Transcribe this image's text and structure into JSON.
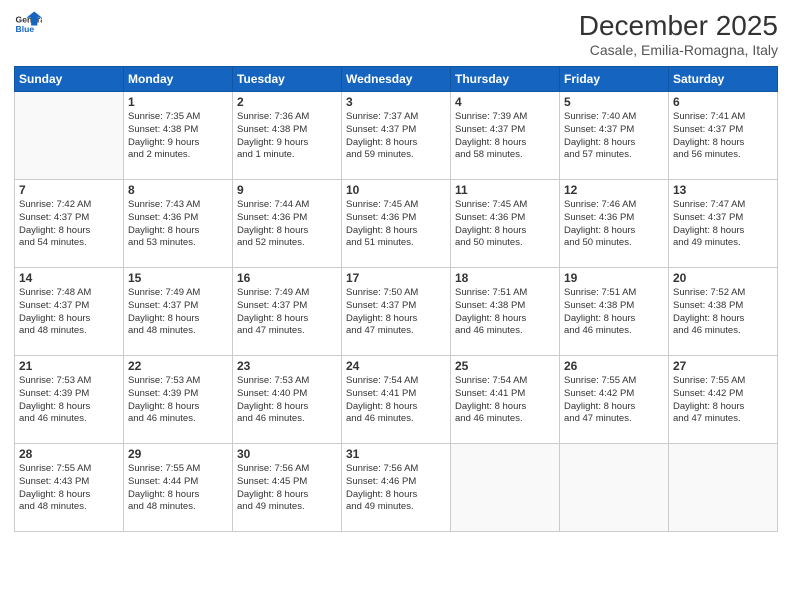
{
  "header": {
    "logo_general": "General",
    "logo_blue": "Blue",
    "month": "December 2025",
    "location": "Casale, Emilia-Romagna, Italy"
  },
  "weekdays": [
    "Sunday",
    "Monday",
    "Tuesday",
    "Wednesday",
    "Thursday",
    "Friday",
    "Saturday"
  ],
  "weeks": [
    [
      {
        "day": "",
        "info": ""
      },
      {
        "day": "1",
        "info": "Sunrise: 7:35 AM\nSunset: 4:38 PM\nDaylight: 9 hours\nand 2 minutes."
      },
      {
        "day": "2",
        "info": "Sunrise: 7:36 AM\nSunset: 4:38 PM\nDaylight: 9 hours\nand 1 minute."
      },
      {
        "day": "3",
        "info": "Sunrise: 7:37 AM\nSunset: 4:37 PM\nDaylight: 8 hours\nand 59 minutes."
      },
      {
        "day": "4",
        "info": "Sunrise: 7:39 AM\nSunset: 4:37 PM\nDaylight: 8 hours\nand 58 minutes."
      },
      {
        "day": "5",
        "info": "Sunrise: 7:40 AM\nSunset: 4:37 PM\nDaylight: 8 hours\nand 57 minutes."
      },
      {
        "day": "6",
        "info": "Sunrise: 7:41 AM\nSunset: 4:37 PM\nDaylight: 8 hours\nand 56 minutes."
      }
    ],
    [
      {
        "day": "7",
        "info": "Sunrise: 7:42 AM\nSunset: 4:37 PM\nDaylight: 8 hours\nand 54 minutes."
      },
      {
        "day": "8",
        "info": "Sunrise: 7:43 AM\nSunset: 4:36 PM\nDaylight: 8 hours\nand 53 minutes."
      },
      {
        "day": "9",
        "info": "Sunrise: 7:44 AM\nSunset: 4:36 PM\nDaylight: 8 hours\nand 52 minutes."
      },
      {
        "day": "10",
        "info": "Sunrise: 7:45 AM\nSunset: 4:36 PM\nDaylight: 8 hours\nand 51 minutes."
      },
      {
        "day": "11",
        "info": "Sunrise: 7:45 AM\nSunset: 4:36 PM\nDaylight: 8 hours\nand 50 minutes."
      },
      {
        "day": "12",
        "info": "Sunrise: 7:46 AM\nSunset: 4:36 PM\nDaylight: 8 hours\nand 50 minutes."
      },
      {
        "day": "13",
        "info": "Sunrise: 7:47 AM\nSunset: 4:37 PM\nDaylight: 8 hours\nand 49 minutes."
      }
    ],
    [
      {
        "day": "14",
        "info": "Sunrise: 7:48 AM\nSunset: 4:37 PM\nDaylight: 8 hours\nand 48 minutes."
      },
      {
        "day": "15",
        "info": "Sunrise: 7:49 AM\nSunset: 4:37 PM\nDaylight: 8 hours\nand 48 minutes."
      },
      {
        "day": "16",
        "info": "Sunrise: 7:49 AM\nSunset: 4:37 PM\nDaylight: 8 hours\nand 47 minutes."
      },
      {
        "day": "17",
        "info": "Sunrise: 7:50 AM\nSunset: 4:37 PM\nDaylight: 8 hours\nand 47 minutes."
      },
      {
        "day": "18",
        "info": "Sunrise: 7:51 AM\nSunset: 4:38 PM\nDaylight: 8 hours\nand 46 minutes."
      },
      {
        "day": "19",
        "info": "Sunrise: 7:51 AM\nSunset: 4:38 PM\nDaylight: 8 hours\nand 46 minutes."
      },
      {
        "day": "20",
        "info": "Sunrise: 7:52 AM\nSunset: 4:38 PM\nDaylight: 8 hours\nand 46 minutes."
      }
    ],
    [
      {
        "day": "21",
        "info": "Sunrise: 7:53 AM\nSunset: 4:39 PM\nDaylight: 8 hours\nand 46 minutes."
      },
      {
        "day": "22",
        "info": "Sunrise: 7:53 AM\nSunset: 4:39 PM\nDaylight: 8 hours\nand 46 minutes."
      },
      {
        "day": "23",
        "info": "Sunrise: 7:53 AM\nSunset: 4:40 PM\nDaylight: 8 hours\nand 46 minutes."
      },
      {
        "day": "24",
        "info": "Sunrise: 7:54 AM\nSunset: 4:41 PM\nDaylight: 8 hours\nand 46 minutes."
      },
      {
        "day": "25",
        "info": "Sunrise: 7:54 AM\nSunset: 4:41 PM\nDaylight: 8 hours\nand 46 minutes."
      },
      {
        "day": "26",
        "info": "Sunrise: 7:55 AM\nSunset: 4:42 PM\nDaylight: 8 hours\nand 47 minutes."
      },
      {
        "day": "27",
        "info": "Sunrise: 7:55 AM\nSunset: 4:42 PM\nDaylight: 8 hours\nand 47 minutes."
      }
    ],
    [
      {
        "day": "28",
        "info": "Sunrise: 7:55 AM\nSunset: 4:43 PM\nDaylight: 8 hours\nand 48 minutes."
      },
      {
        "day": "29",
        "info": "Sunrise: 7:55 AM\nSunset: 4:44 PM\nDaylight: 8 hours\nand 48 minutes."
      },
      {
        "day": "30",
        "info": "Sunrise: 7:56 AM\nSunset: 4:45 PM\nDaylight: 8 hours\nand 49 minutes."
      },
      {
        "day": "31",
        "info": "Sunrise: 7:56 AM\nSunset: 4:46 PM\nDaylight: 8 hours\nand 49 minutes."
      },
      {
        "day": "",
        "info": ""
      },
      {
        "day": "",
        "info": ""
      },
      {
        "day": "",
        "info": ""
      }
    ]
  ]
}
